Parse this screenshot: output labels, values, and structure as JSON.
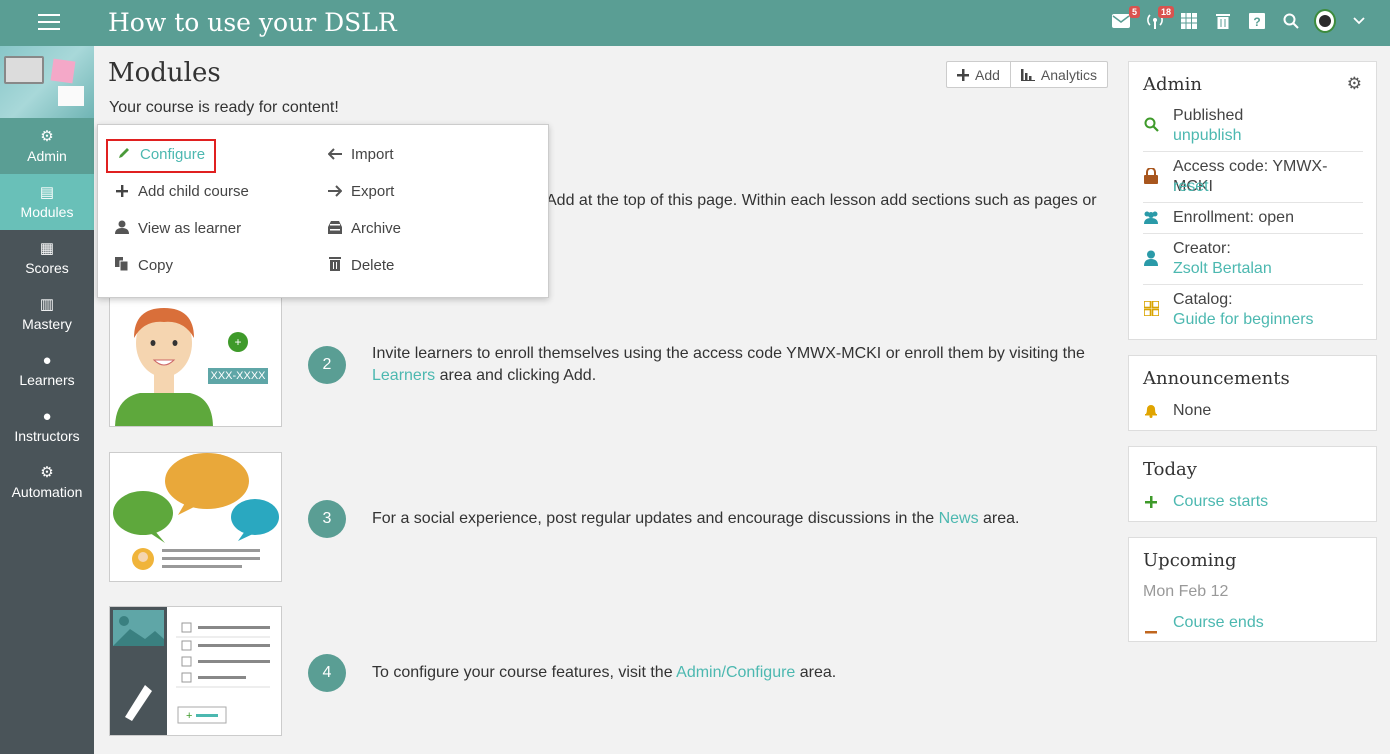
{
  "app": {
    "title": "How to use your DSLR"
  },
  "topbar": {
    "mail_badge": "5",
    "signal_badge": "18"
  },
  "sidebar": {
    "items": [
      {
        "label": "Admin",
        "icon": "gear-icon"
      },
      {
        "label": "Modules",
        "icon": "book-icon"
      },
      {
        "label": "Scores",
        "icon": "table-icon"
      },
      {
        "label": "Mastery",
        "icon": "bar-chart-icon"
      },
      {
        "label": "Learners",
        "icon": "person-icon"
      },
      {
        "label": "Instructors",
        "icon": "instructor-icon"
      },
      {
        "label": "Automation",
        "icon": "cogs-icon"
      }
    ]
  },
  "main": {
    "title": "Modules",
    "subtitle": "Your course is ready for content!",
    "add_label": "Add",
    "analytics_label": "Analytics"
  },
  "steps": {
    "step1_line1": "Add at the top of this page. Within each lesson add sections such as pages or",
    "step2_num": "2",
    "step2_line1": "Invite learners to enroll themselves using the access code YMWX-MCKI or enroll them by visiting the",
    "step2_link": "Learners",
    "step2_rest": " area and clicking Add.",
    "step3_num": "3",
    "step3_text": "For a social experience, post regular updates and encourage discussions in the ",
    "step3_link": "News",
    "step3_rest": " area.",
    "step4_num": "4",
    "step4_text": "To configure your course features, visit the ",
    "step4_link": "Admin/Configure",
    "step4_rest": " area.",
    "illus2_code": "XXX-XXXX"
  },
  "dropdown": {
    "configure": "Configure",
    "add_child": "Add child course",
    "view_as_learner": "View as learner",
    "copy": "Copy",
    "import": "Import",
    "export": "Export",
    "archive": "Archive",
    "delete": "Delete"
  },
  "admin_panel": {
    "title": "Admin",
    "published": "Published",
    "unpublish": "unpublish",
    "access_code": "Access code: YMWX-MCKI",
    "reset": "reset",
    "enrollment": "Enrollment: open",
    "creator_label": "Creator:",
    "creator_name": "Zsolt Bertalan",
    "catalog_label": "Catalog:",
    "catalog_name": "Guide for beginners"
  },
  "announcements": {
    "title": "Announcements",
    "value": "None"
  },
  "today": {
    "title": "Today",
    "item": "Course starts"
  },
  "upcoming": {
    "title": "Upcoming",
    "date": "Mon Feb 12",
    "item": "Course ends"
  },
  "colors": {
    "header": "#5a9e94",
    "accent": "#4cb8b0",
    "sidebar": "#4a5459",
    "highlight": "#e02020"
  }
}
